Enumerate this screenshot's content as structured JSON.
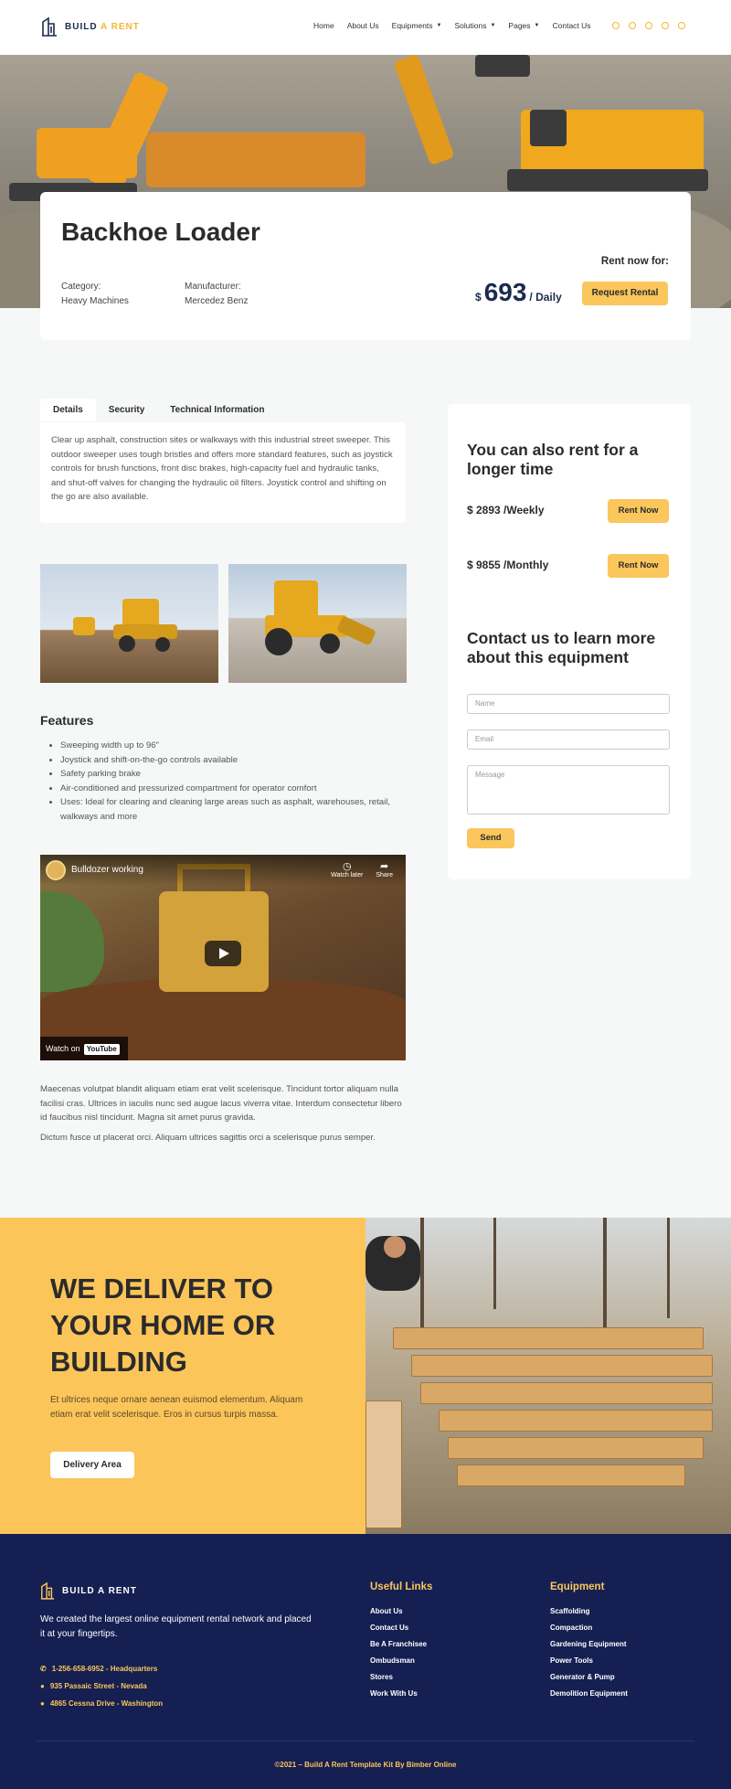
{
  "header": {
    "logo_text_1": "BUILD",
    "logo_text_2": "A RENT",
    "nav": [
      {
        "label": "Home"
      },
      {
        "label": "About Us"
      },
      {
        "label": "Equipments",
        "dropdown": true
      },
      {
        "label": "Solutions",
        "dropdown": true
      },
      {
        "label": "Pages",
        "dropdown": true
      },
      {
        "label": "Contact Us"
      }
    ],
    "socials": [
      "instagram-icon",
      "facebook-icon",
      "twitter-icon",
      "youtube-icon",
      "pinterest-icon"
    ]
  },
  "product": {
    "title": "Backhoe Loader",
    "category_label": "Category:",
    "category_value": "Heavy Machines",
    "manufacturer_label": "Manufacturer:",
    "manufacturer_value": "Mercedez Benz",
    "rent_label": "Rent now for:",
    "currency": "$",
    "price": "693",
    "period": "/ Daily",
    "request_button": "Request Rental"
  },
  "tabs": {
    "items": [
      "Details",
      "Security",
      "Technical Information"
    ],
    "active": "Details",
    "details_text": "Clear up asphalt, construction sites or walkways with this industrial street sweeper. This outdoor sweeper uses tough bristles and offers more standard features, such as joystick controls for brush functions, front disc brakes, high-capacity fuel and hydraulic tanks, and shut-off valves for changing the hydraulic oil filters. Joystick control and shifting on the go are also available."
  },
  "features": {
    "title": "Features",
    "items": [
      "Sweeping width up to 96\"",
      "Joystick and shift-on-the-go controls available",
      "Safety parking brake",
      "Air-conditioned and pressurized compartment for operator comfort",
      "Uses: Ideal for clearing and cleaning large areas such as asphalt, warehouses, retail, walkways and more"
    ]
  },
  "video": {
    "title": "Bulldozer working",
    "watch_later": "Watch later",
    "share": "Share",
    "watch_on": "Watch on",
    "youtube": "YouTube"
  },
  "body_text": {
    "p1": "Maecenas volutpat blandit aliquam etiam erat velit scelerisque. Tincidunt tortor aliquam nulla facilisi cras. Ultrices in iaculis nunc sed augue lacus viverra vitae. Interdum consectetur libero id faucibus nisl tincidunt. Magna sit amet purus gravida.",
    "p2": "Dictum fusce ut placerat orci. Aliquam ultrices sagittis orci a scelerisque purus semper."
  },
  "sidebar": {
    "longer_title": "You can also rent for a longer time",
    "weekly_price": "$ 2893",
    "weekly_period": "/Weekly",
    "monthly_price": "$ 9855",
    "monthly_period": "/Monthly",
    "rent_now": "Rent Now",
    "contact_title": "Contact us to learn more about this equipment",
    "name_placeholder": "Name",
    "email_placeholder": "Email",
    "message_placeholder": "Message",
    "send": "Send"
  },
  "delivery": {
    "title": "WE DELIVER TO YOUR HOME OR BUILDING",
    "text": "Et ultrices neque ornare aenean euismod elementum. Aliquam etiam erat velit scelerisque. Eros in cursus turpis massa.",
    "button": "Delivery Area"
  },
  "footer": {
    "logo": "BUILD A RENT",
    "description": "We created the largest online equipment rental network and placed it at your fingertips.",
    "phone": "1-256-658-6952 - Headquarters",
    "address1": "935 Passaic Street - Nevada",
    "address2": "4865 Cessna Drive - Washington",
    "useful_links_title": "Useful Links",
    "useful_links": [
      "About Us",
      "Contact Us",
      "Be A Franchisee",
      "Ombudsman",
      "Stores",
      "Work With Us"
    ],
    "equipment_title": "Equipment",
    "equipment_links": [
      "Scaffolding",
      "Compaction",
      "Gardening Equipment",
      "Power Tools",
      "Generator & Pump",
      "Demolition Equipment"
    ],
    "copyright": "©2021 – Build A Rent Template Kit By Bimber Online"
  },
  "colors": {
    "accent": "#fbc65b",
    "navy": "#151f52",
    "dark_text": "#2b2b2b"
  }
}
